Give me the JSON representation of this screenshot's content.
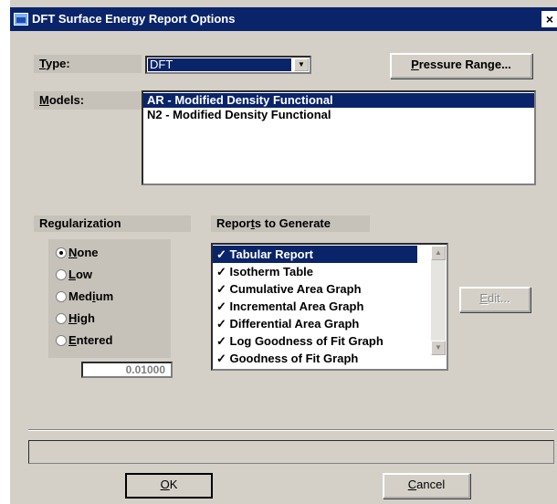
{
  "window": {
    "title": "DFT Surface Energy Report Options",
    "close_label": "×"
  },
  "type": {
    "label_prefix": "",
    "label_accel": "T",
    "label_rest": "ype:",
    "value": "DFT"
  },
  "pressure_button": {
    "accel": "P",
    "rest": "ressure Range..."
  },
  "models": {
    "label_accel": "M",
    "label_rest": "odels:",
    "items": [
      "AR - Modified Density Functional",
      "N2 - Modified Density Functional"
    ]
  },
  "regularization": {
    "title": "Regularization",
    "options": [
      {
        "accel": "N",
        "rest": "one",
        "selected": true
      },
      {
        "accel": "L",
        "rest": "ow",
        "selected": false
      },
      {
        "prefix": "Med",
        "accel": "i",
        "rest": "um",
        "selected": false
      },
      {
        "accel": "H",
        "rest": "igh",
        "selected": false
      },
      {
        "accel": "E",
        "rest": "ntered",
        "selected": false
      }
    ],
    "entered_value": "0.01000"
  },
  "reports": {
    "title_prefix": "Repor",
    "title_accel": "t",
    "title_rest": "s to Generate",
    "items": [
      "✓ Tabular Report",
      "✓ Isotherm Table",
      "✓ Cumulative Area Graph",
      "✓ Incremental Area Graph",
      "✓ Differential Area Graph",
      "✓ Log Goodness of Fit Graph",
      "✓ Goodness of Fit Graph"
    ]
  },
  "edit_button": {
    "accel": "E",
    "rest": "dit..."
  },
  "ok_button": {
    "accel": "O",
    "rest": "K"
  },
  "cancel_button": {
    "accel": "C",
    "rest": "ancel"
  }
}
